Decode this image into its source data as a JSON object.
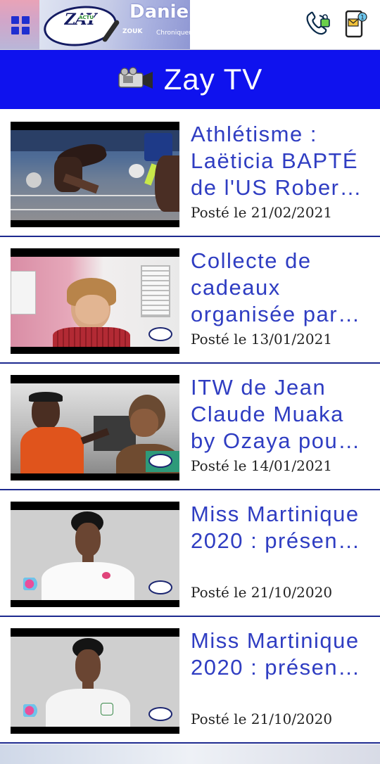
{
  "header": {
    "menu_icon": "grid-menu-icon",
    "banner": {
      "logo_text": "ZAY",
      "logo_sub": "ACTU",
      "name": "Danie",
      "station": "ZOUK",
      "chron": "Chroniqueu"
    },
    "icons": [
      "phone-call-icon",
      "mobile-mail-icon"
    ]
  },
  "titlebar": {
    "icon": "video-camera-icon",
    "title": "Zay TV",
    "color": "#0f12ee"
  },
  "videos": [
    {
      "title": "Athlétisme : Laëticia BAPTÉ de l'US Rober…",
      "date": "Posté le 21/02/2021"
    },
    {
      "title": "Collecte de cadeaux organisée par…",
      "date": "Posté le 13/01/2021"
    },
    {
      "title": "ITW de Jean Claude Muaka by Ozaya pou…",
      "date": "Posté le 14/01/2021"
    },
    {
      "title": "Miss Martinique 2020 : présen…",
      "date": "Posté le 21/10/2020"
    },
    {
      "title": "Miss Martinique 2020 : présen…",
      "date": "Posté le 21/10/2020"
    }
  ],
  "colors": {
    "title_text": "#2f3dc2",
    "divider": "#1d2a8f"
  }
}
